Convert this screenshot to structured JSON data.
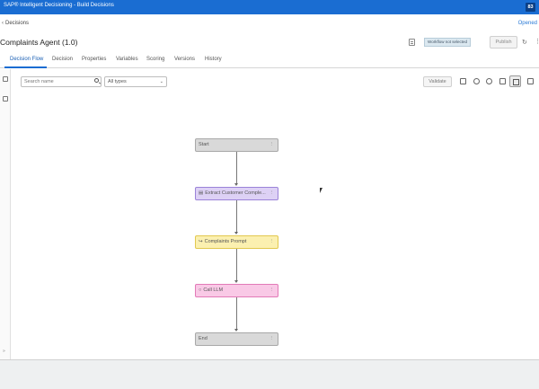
{
  "app": {
    "title": "SAP® Intelligent Decisioning - Build Decisions",
    "user_badge": "83"
  },
  "breadcrumb": {
    "label": "Decisions",
    "opened_label": "Opened"
  },
  "header": {
    "title": "Complaints Agent (1.0)",
    "workflow_status": "Workflow not selected",
    "publish_label": "Publish"
  },
  "tabs": [
    {
      "label": "Decision Flow"
    },
    {
      "label": "Decision"
    },
    {
      "label": "Properties"
    },
    {
      "label": "Variables"
    },
    {
      "label": "Scoring"
    },
    {
      "label": "Versions"
    },
    {
      "label": "History"
    }
  ],
  "toolbar": {
    "search_placeholder": "Search name",
    "type_filter": "All types",
    "validate_label": "Validate"
  },
  "flow": {
    "nodes": [
      {
        "label": "Start",
        "kind": "start",
        "color": "#d9d9d9"
      },
      {
        "label": "Extract Customer Comple...",
        "kind": "code",
        "color": "#ddd1f5"
      },
      {
        "label": "Complaints Prompt",
        "kind": "prompt",
        "color": "#fbf0b0"
      },
      {
        "label": "Call LLM",
        "kind": "llm",
        "color": "#f9c9e6"
      },
      {
        "label": "End",
        "kind": "end",
        "color": "#d9d9d9"
      }
    ]
  },
  "colors": {
    "topbar": "#1a6dd2",
    "accent": "#1a6dd2"
  }
}
